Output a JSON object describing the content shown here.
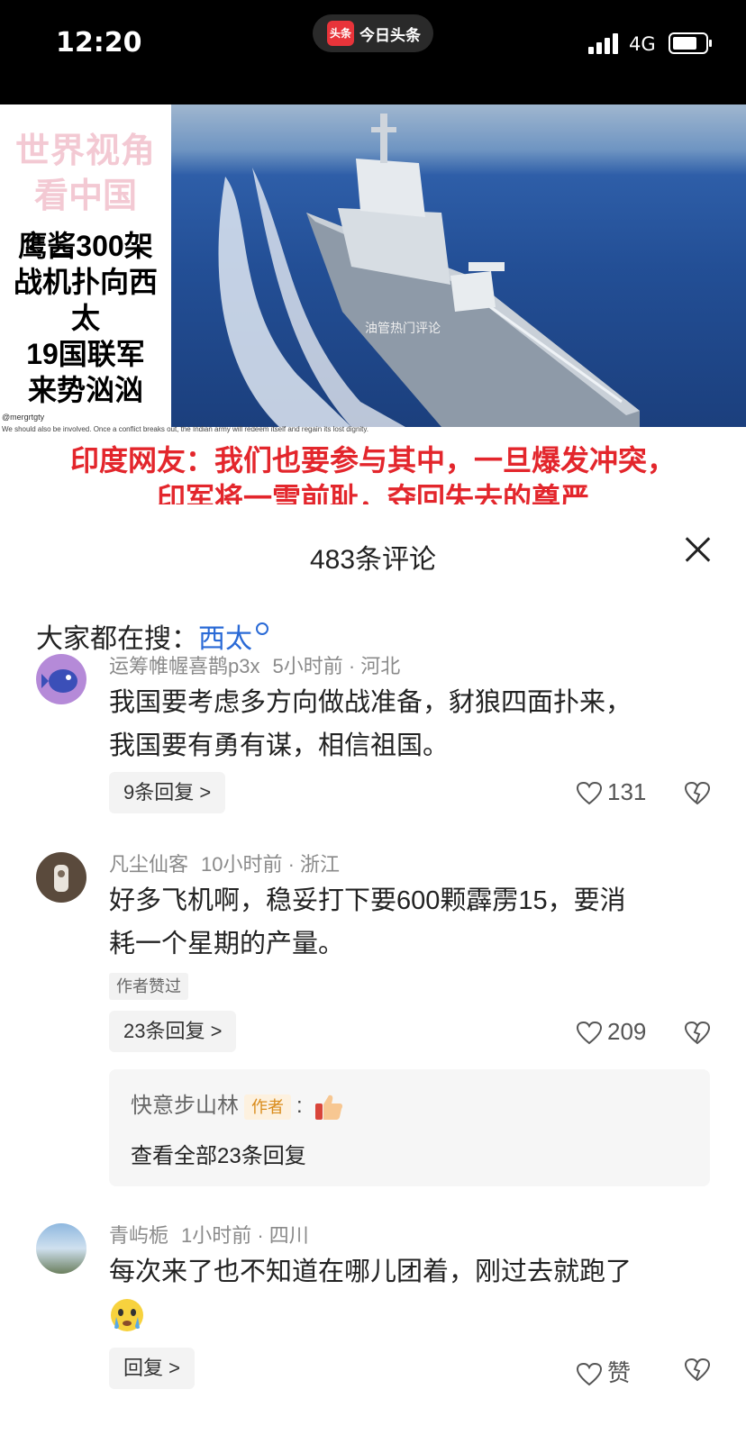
{
  "status_bar": {
    "time": "12:20",
    "app_name": "今日头条",
    "app_logo_text": "头条",
    "network": "4G",
    "icons": [
      "signal-icon",
      "battery-icon"
    ]
  },
  "video": {
    "promo_line1": "世界视角",
    "promo_line2": "看中国",
    "headline": [
      "鹰酱300架",
      "战机扑向西太",
      "19国联军",
      "来势汹汹"
    ],
    "watermark": "油管热门评论",
    "handle": "@mergrtgty",
    "quote_en": "We should also be involved. Once a conflict breaks out, the Indian army will redeem itself and regain its lost dignity.",
    "caption_line1": "印度网友：我们也要参与其中，一旦爆发冲突，",
    "caption_line2": "印军将一雪前耻，夺回失去的尊严"
  },
  "comments": {
    "title": "483条评论",
    "search_prefix": "大家都在搜：",
    "search_term": "西太",
    "items": [
      {
        "name": "运筹帷幄喜鹊p3x",
        "time": "5小时前 · 河北",
        "text_line1": "我国要考虑多方向做战准备，豺狼四面扑来，",
        "text_line2": "我国要有勇有谋，相信祖国。",
        "replies": "9条回复 >",
        "likes": "131"
      },
      {
        "name": "凡尘仙客",
        "time": "10小时前 · 浙江",
        "text_line1": "好多飞机啊，稳妥打下要600颗霹雳15，要消",
        "text_line2": "耗一个星期的产量。",
        "tag": "作者赞过",
        "replies": "23条回复 >",
        "likes": "209",
        "sub_reply": {
          "name": "快意步山林",
          "badge": "作者",
          "colon": ":",
          "view_all": "查看全部23条回复"
        }
      },
      {
        "name": "青屿栀",
        "time": "1小时前 · 四川",
        "text_line1": "每次来了也不知道在哪儿团着，刚过去就跑了",
        "replies": "回复 >",
        "likes": "赞"
      }
    ]
  },
  "colors": {
    "accent_link": "#2a6ad6",
    "caption_red": "#e3262c",
    "badge_orange": "#d98b1a"
  }
}
